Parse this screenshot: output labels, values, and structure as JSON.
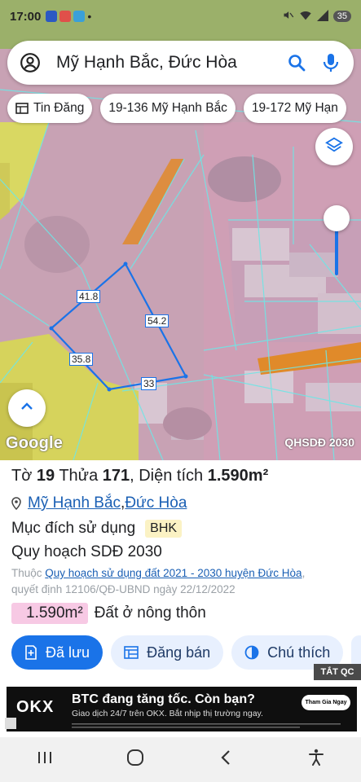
{
  "status_bar": {
    "time": "17:00",
    "battery": "35"
  },
  "search": {
    "query": "Mỹ Hạnh Bắc, Đức Hòa"
  },
  "chips": [
    {
      "label": "Tin Đăng",
      "icon": "table-icon"
    },
    {
      "label": "19-136 Mỹ Hạnh Bắc"
    },
    {
      "label": "19-172 Mỹ Hạn"
    }
  ],
  "map": {
    "edge_labels": [
      "41.8",
      "54.2",
      "35.8",
      "33"
    ],
    "logo": "Google",
    "source_label": "QHSDĐ 2030",
    "colors": {
      "parcel_outline": "#1a73e8",
      "residential_pink": "#d7a9bf",
      "agri_yellow": "#d9d862",
      "transport_orange": "#e08a2a"
    }
  },
  "parcel": {
    "sheet_prefix": "Tờ ",
    "sheet": "19",
    "plot_prefix": " Thửa ",
    "plot": "171",
    "area_prefix": ", Diện tích ",
    "area": "1.590m²",
    "commune": "Mỹ Hạnh Bắc",
    "separator": ", ",
    "district": "Đức Hòa",
    "purpose_label": "Mục đích sử dụng",
    "purpose_code": "BHK",
    "plan_title": "Quy hoạch SDĐ 2030",
    "ref_prefix": "Thuộc ",
    "ref_link": "Quy hoạch sử dụng đất 2021 - 2030 huyện Đức Hòa",
    "ref_suffix": ",",
    "decision": "quyết định 12106/QĐ-UBND ngày 22/12/2022",
    "zone_area": "1.590m²",
    "zone_type": "Đất ở nông thôn"
  },
  "actions": [
    {
      "label": "Đã lưu",
      "icon": "bookmark-add-icon",
      "primary": true
    },
    {
      "label": "Đăng bán",
      "icon": "listing-icon",
      "primary": false
    },
    {
      "label": "Chú thích",
      "icon": "contrast-icon",
      "primary": false
    }
  ],
  "ad": {
    "close_label": "TẮT QC",
    "brand": "OKX",
    "title": "BTC đang tăng tốc. Còn bạn?",
    "subtitle": "Giao dịch 24/7 trên OKX. Bắt nhịp thị trường ngay.",
    "cta": "Tham Gia Ngay"
  }
}
